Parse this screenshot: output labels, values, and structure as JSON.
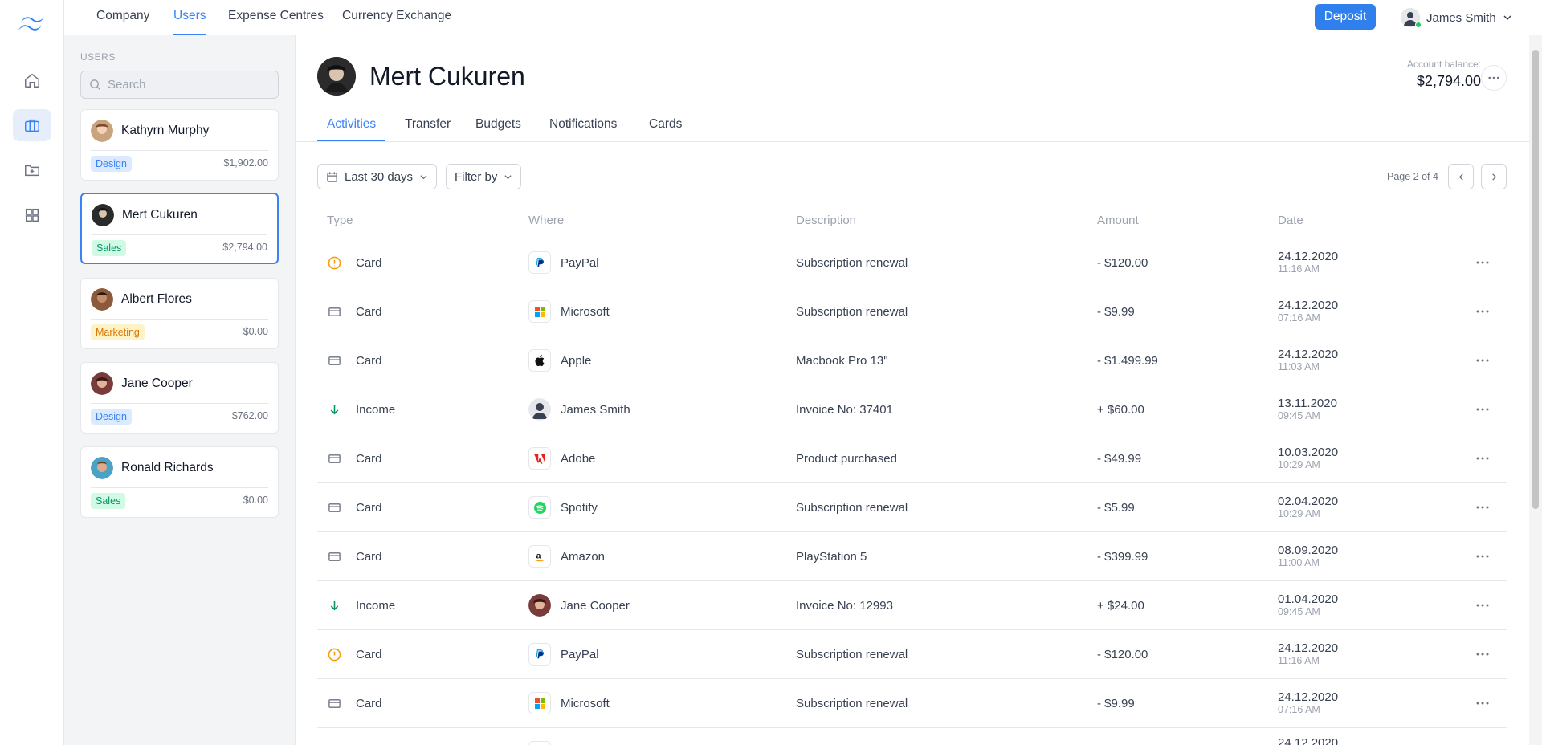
{
  "nav": {
    "items": [
      "Company",
      "Users",
      "Expense Centres",
      "Currency Exchange"
    ],
    "deposit_label": "Deposit",
    "user_name": "James Smith"
  },
  "users": {
    "heading": "USERS",
    "search_placeholder": "Search",
    "list": [
      {
        "name": "Kathyrn Murphy",
        "tag": "Design",
        "amount": "$1,902.00"
      },
      {
        "name": "Mert Cukuren",
        "tag": "Sales",
        "amount": "$2,794.00"
      },
      {
        "name": "Albert Flores",
        "tag": "Marketing",
        "amount": "$0.00"
      },
      {
        "name": "Jane Cooper",
        "tag": "Design",
        "amount": "$762.00"
      },
      {
        "name": "Ronald Richards",
        "tag": "Sales",
        "amount": "$0.00"
      }
    ]
  },
  "profile": {
    "name": "Mert Cukuren",
    "balance_label": "Account balance:",
    "balance": "$2,794.00"
  },
  "tabs": [
    "Activities",
    "Transfer",
    "Budgets",
    "Notifications",
    "Cards"
  ],
  "filters": {
    "range": "Last 30 days",
    "filter_by": "Filter by",
    "page_text": "Page 2 of 4"
  },
  "table": {
    "headers": [
      "Type",
      "Where",
      "Description",
      "Amount",
      "Date"
    ],
    "rows": [
      {
        "type": "Card",
        "type_icon": "warning-icon",
        "where": "PayPal",
        "where_icon": "paypal-logo",
        "description": "Subscription renewal",
        "amount": "- $120.00",
        "date": "24.12.2020",
        "time": "11:16 AM"
      },
      {
        "type": "Card",
        "type_icon": "card-icon",
        "where": "Microsoft",
        "where_icon": "microsoft-logo",
        "description": "Subscription renewal",
        "amount": "- $9.99",
        "date": "24.12.2020",
        "time": "07:16 AM"
      },
      {
        "type": "Card",
        "type_icon": "card-icon",
        "where": "Apple",
        "where_icon": "apple-logo",
        "description": "Macbook Pro 13\"",
        "amount": "- $1.499.99",
        "date": "24.12.2020",
        "time": "11:03 AM"
      },
      {
        "type": "Income",
        "type_icon": "arrow-down-icon",
        "where": "James Smith",
        "where_icon": "avatar",
        "description": "Invoice No: 37401",
        "amount": "+ $60.00",
        "date": "13.11.2020",
        "time": "09:45 AM"
      },
      {
        "type": "Card",
        "type_icon": "card-icon",
        "where": "Adobe",
        "where_icon": "adobe-logo",
        "description": "Product purchased",
        "amount": "- $49.99",
        "date": "10.03.2020",
        "time": "10:29 AM"
      },
      {
        "type": "Card",
        "type_icon": "card-icon",
        "where": "Spotify",
        "where_icon": "spotify-logo",
        "description": "Subscription renewal",
        "amount": "- $5.99",
        "date": "02.04.2020",
        "time": "10:29 AM"
      },
      {
        "type": "Card",
        "type_icon": "card-icon",
        "where": "Amazon",
        "where_icon": "amazon-logo",
        "description": "PlayStation 5",
        "amount": "- $399.99",
        "date": "08.09.2020",
        "time": "11:00 AM"
      },
      {
        "type": "Income",
        "type_icon": "arrow-down-icon",
        "where": "Jane Cooper",
        "where_icon": "avatar",
        "description": "Invoice No: 12993",
        "amount": "+ $24.00",
        "date": "01.04.2020",
        "time": "09:45 AM"
      },
      {
        "type": "Card",
        "type_icon": "warning-icon",
        "where": "PayPal",
        "where_icon": "paypal-logo",
        "description": "Subscription renewal",
        "amount": "- $120.00",
        "date": "24.12.2020",
        "time": "11:16 AM"
      },
      {
        "type": "Card",
        "type_icon": "card-icon",
        "where": "Microsoft",
        "where_icon": "microsoft-logo",
        "description": "Subscription renewal",
        "amount": "- $9.99",
        "date": "24.12.2020",
        "time": "07:16 AM"
      },
      {
        "date": "24.12.2020"
      }
    ]
  },
  "colors": {
    "accent": "#3b82f6",
    "deposit": "#2f80ed",
    "negative": "#dc2626",
    "positive": "#059669",
    "warning": "#f59e0b"
  }
}
